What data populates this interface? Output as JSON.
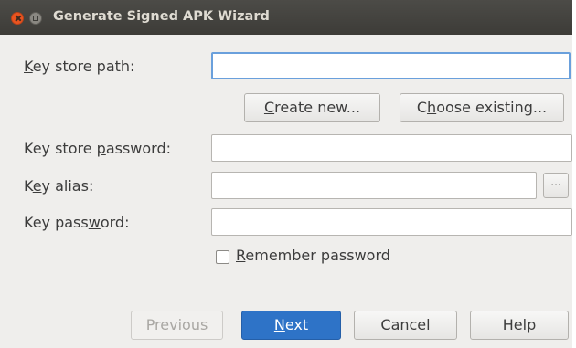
{
  "window": {
    "title": "Generate Signed APK Wizard"
  },
  "form": {
    "keystore_path": {
      "label_mnemonic": "K",
      "label_rest": "ey store path:",
      "value": ""
    },
    "create_new": {
      "mnemonic": "C",
      "rest": "reate new..."
    },
    "choose_existing": {
      "pre": "C",
      "mnemonic": "h",
      "rest": "oose existing..."
    },
    "keystore_password": {
      "label_pre": "Key store ",
      "label_mnemonic": "p",
      "label_rest": "assword:",
      "value": ""
    },
    "key_alias": {
      "label_pre": "K",
      "label_mnemonic": "e",
      "label_rest": "y alias:",
      "value": "",
      "browse_label": "..."
    },
    "key_password": {
      "label_pre": "Key pass",
      "label_mnemonic": "w",
      "label_rest": "ord:",
      "value": ""
    },
    "remember_password": {
      "mnemonic": "R",
      "rest": "emember password",
      "checked": false
    }
  },
  "footer": {
    "previous": "Previous",
    "next_mnemonic": "N",
    "next_rest": "ext",
    "cancel": "Cancel",
    "help": "Help"
  }
}
